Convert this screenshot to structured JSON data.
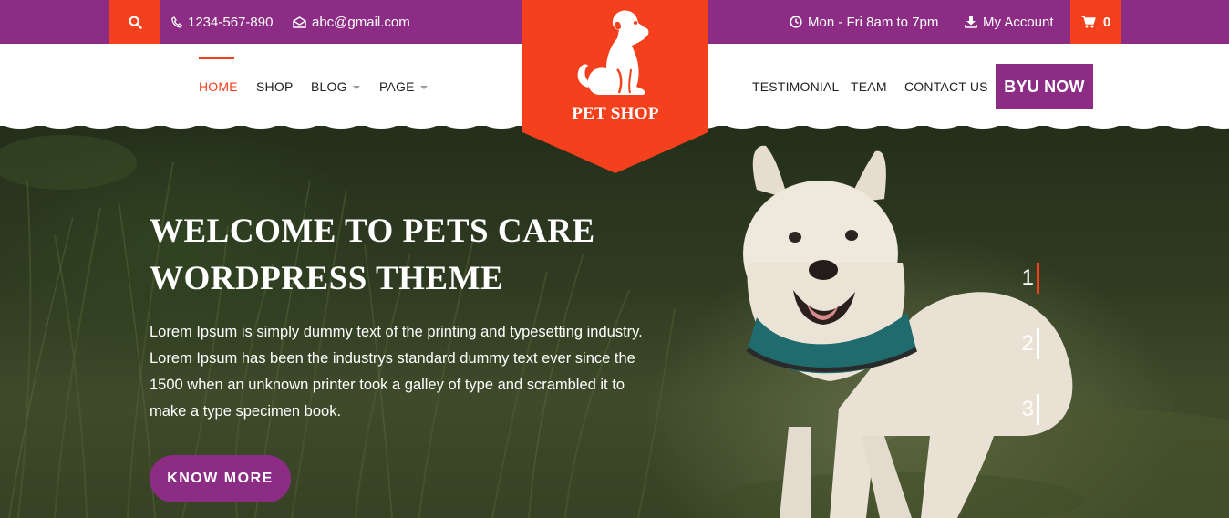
{
  "colors": {
    "purple": "#8c2c84",
    "orange": "#f4401d",
    "white": "#ffffff"
  },
  "topbar": {
    "phone": "1234-567-890",
    "email": "abc@gmail.com",
    "hours": "Mon - Fri 8am to 7pm",
    "account": "My Account",
    "cart_count": "0",
    "icons": [
      "search-icon",
      "phone-icon",
      "mail-icon",
      "clock-icon",
      "download-icon",
      "cart-icon"
    ]
  },
  "logo": {
    "text": "PET SHOP",
    "icon": "dog-icon"
  },
  "nav": {
    "left": [
      {
        "label": "HOME",
        "active": true
      },
      {
        "label": "SHOP"
      },
      {
        "label": "BLOG",
        "dropdown": true
      },
      {
        "label": "PAGE",
        "dropdown": true
      }
    ],
    "right": [
      {
        "label": "TESTIMONIAL"
      },
      {
        "label": "TEAM"
      },
      {
        "label": "CONTACT US"
      }
    ],
    "buy_label": "BYU NOW"
  },
  "hero": {
    "title_line1": "WELCOME TO PETS CARE",
    "title_line2": "WORDPRESS THEME",
    "text": "Lorem Ipsum is simply dummy text of the printing and typesetting industry. Lorem Ipsum has been the industrys standard dummy text ever since the 1500 when an unknown printer took a galley of type and scrambled it to make a type specimen book.",
    "button": "KNOW MORE"
  },
  "slider": {
    "pages": [
      "1",
      "2",
      "3"
    ],
    "active": "1"
  }
}
